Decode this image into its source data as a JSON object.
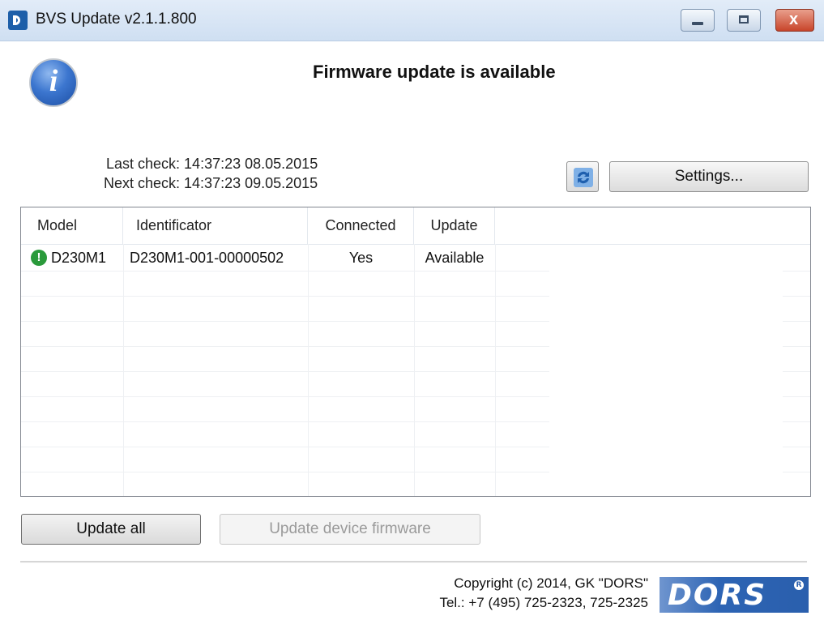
{
  "window": {
    "title": "BVS Update v2.1.1.800",
    "min_icon": "minimize-icon",
    "max_icon": "maximize-icon",
    "close_glyph": "x"
  },
  "header": {
    "info_icon": "info-icon",
    "info_glyph": "i",
    "headline": "Firmware update is available"
  },
  "checks": {
    "last": "Last check: 14:37:23 08.05.2015",
    "next": "Next check: 14:37:23 09.05.2015"
  },
  "toolbar": {
    "refresh_icon": "refresh-icon",
    "settings_label": "Settings..."
  },
  "table": {
    "columns": [
      "Model",
      "Identificator",
      "Connected",
      "Update"
    ],
    "rows": [
      {
        "status_icon": "warning-icon",
        "status_glyph": "!",
        "model": "D230M1",
        "identificator": "D230M1-001-00000502",
        "connected": "Yes",
        "update": "Available"
      }
    ]
  },
  "buttons": {
    "update_all": "Update all",
    "update_device_firmware": "Update device firmware"
  },
  "footer": {
    "copyright": "Copyright (c) 2014, GK \"DORS\"",
    "phone": "Tel.: +7 (495) 725-2323, 725-2325",
    "logo_text": "DORS",
    "logo_reg": "R"
  },
  "colors": {
    "title_bar": "#cfdff2",
    "close_button": "#c8452b",
    "logo_blue": "#2a5fad",
    "status_green": "#2a9a3b"
  }
}
